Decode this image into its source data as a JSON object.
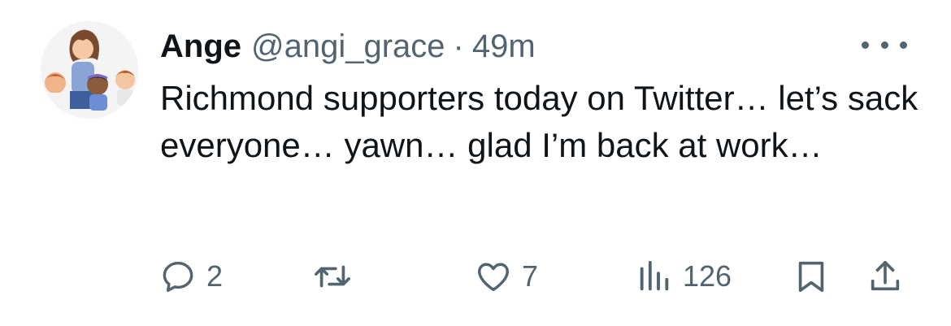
{
  "tweet": {
    "author": {
      "display_name": "Ange",
      "handle": "@angi_grace",
      "separator": "·",
      "time": "49m"
    },
    "text": "Richmond supporters today on Twitter… let’s sack everyone… yawn… glad I’m back at work…",
    "actions": {
      "reply_count": "2",
      "retweet_count": "",
      "like_count": "7",
      "views_count": "126"
    }
  },
  "icons": {
    "more": "more-horizontal-icon",
    "reply": "reply-bubble-icon",
    "retweet": "retweet-icon",
    "like": "heart-icon",
    "views": "analytics-bars-icon",
    "bookmark": "bookmark-icon",
    "share": "share-upload-icon"
  },
  "colors": {
    "text": "#0f1419",
    "secondary": "#536471",
    "background": "#ffffff"
  }
}
